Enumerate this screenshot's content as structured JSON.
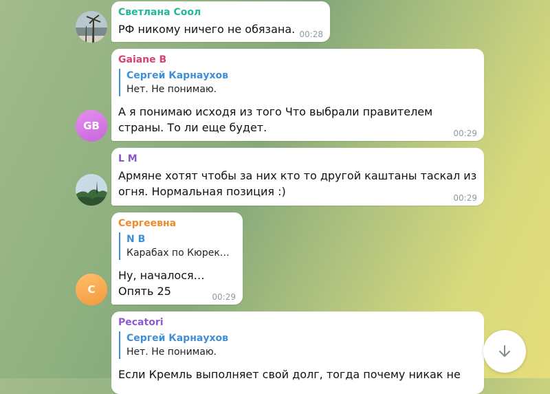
{
  "messages": [
    {
      "sender": "Светлана Соол",
      "sender_color": "#22b79a",
      "text": "РФ никому ничего не обязана.",
      "time": "00:28"
    },
    {
      "sender": "Gaiane B",
      "sender_color": "#d0446e",
      "avatar_initials": "GB",
      "reply": {
        "name": "Сергей Карнаухов",
        "text": "Нет. Не понимаю."
      },
      "text_line1": "А я понимаю исходя из того Что выбрали правителем",
      "text_line2": "страны. То ли еще будет.",
      "time": "00:29"
    },
    {
      "sender": "L M",
      "sender_color": "#8b58c9",
      "text_line1": "Армяне хотят чтобы за них кто то другой каштаны таскал из",
      "text_line2": "огня. Нормальная позиция :)",
      "time": "00:29"
    },
    {
      "sender": "Сергеевна",
      "sender_color": "#ef8a2a",
      "avatar_initials": "С",
      "reply": {
        "name": "N B",
        "text": "Карабах по Кюрек…"
      },
      "text_line1": "Ну, началося…",
      "text_line2": "Опять 25",
      "time": "00:29"
    },
    {
      "sender": "Pecatori",
      "sender_color": "#8e5ad8",
      "reply": {
        "name": "Сергей Карнаухов",
        "text": "Нет. Не понимаю."
      },
      "text": "Если Кремль выполняет свой долг, тогда почему никак не"
    }
  ],
  "scroll_button": {
    "icon": "arrow-down-icon"
  }
}
